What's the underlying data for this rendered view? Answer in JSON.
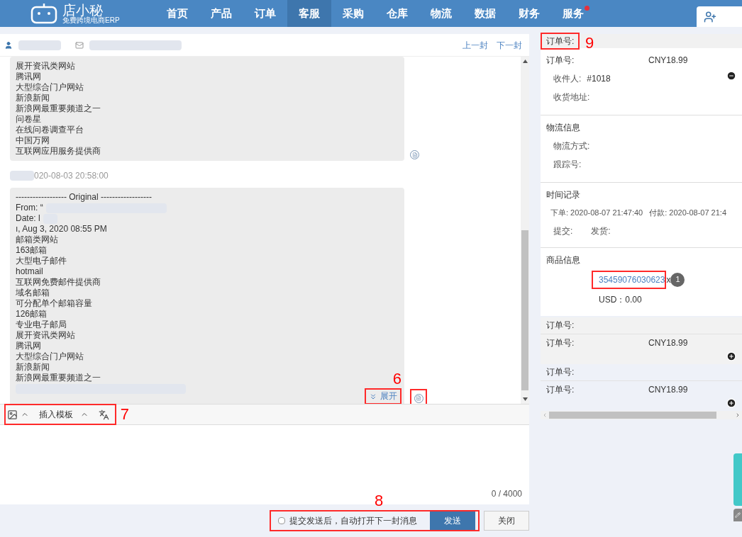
{
  "header": {
    "logo_title": "店小秘",
    "logo_subtitle": "免费跨境电商ERP",
    "nav": [
      {
        "label": "首页",
        "selected": false,
        "dot": false
      },
      {
        "label": "产品",
        "selected": false,
        "dot": false
      },
      {
        "label": "订单",
        "selected": false,
        "dot": false
      },
      {
        "label": "客服",
        "selected": true,
        "dot": false
      },
      {
        "label": "采购",
        "selected": false,
        "dot": false
      },
      {
        "label": "仓库",
        "selected": false,
        "dot": false
      },
      {
        "label": "物流",
        "selected": false,
        "dot": false
      },
      {
        "label": "数据",
        "selected": false,
        "dot": false
      },
      {
        "label": "财务",
        "selected": false,
        "dot": false
      },
      {
        "label": "服务",
        "selected": false,
        "dot": true
      }
    ]
  },
  "conversation": {
    "prev_link": "上一封",
    "next_link": "下一封",
    "messages": [
      {
        "lines": [
          "展开资讯类网站",
          "腾讯网",
          "大型综合门户网站",
          "新浪新闻",
          "新浪网最重要频道之一",
          "问卷星",
          "在线问卷调查平台",
          "中国万网",
          "互联网应用服务提供商"
        ]
      },
      {
        "timestamp": "020-08-03 20:58:00",
        "lines": [
          "------------------ Original ------------------",
          "From: “",
          "Date: l",
          "ı, Aug 3, 2020 08:55 PM",
          "邮箱类网站",
          "163邮箱",
          "大型电子邮件",
          "hotmail",
          "互联网免费邮件提供商",
          "域名邮箱",
          "可分配单个邮箱容量",
          "126邮箱",
          "专业电子邮局",
          "展开资讯类网站",
          "腾讯网",
          "大型综合门户网站",
          "新浪新闻",
          "新浪网最重要频道之一"
        ],
        "expand": "展开"
      }
    ],
    "toolbar": {
      "template_label": "插入模板"
    },
    "reply": {
      "counter": "0 / 4000"
    },
    "auto_next": {
      "label": "提交发送后，自动打开下一封消息",
      "checked": false
    },
    "send_button": "发送",
    "close_button": "关闭"
  },
  "order_panel": {
    "title": "订单号:",
    "order": {
      "number_label": "订单号:",
      "amount": "CNY18.99",
      "recipient_label": "收件人:",
      "recipient": "#1018",
      "address_label": "收货地址:"
    },
    "logistics": {
      "title": "物流信息",
      "method_label": "物流方式:",
      "tracking_label": "跟踪号:"
    },
    "timeline": {
      "title": "时间记录",
      "ordered_label": "下单:",
      "ordered": "2020-08-07 21:47:40",
      "paid_label": "付款:",
      "paid": "2020-08-07 21:4",
      "submitted_label": "提交:",
      "shipped_label": "发货:"
    },
    "products": {
      "title": "商品信息",
      "sku": "35459076030623",
      "times": "x",
      "quantity": "1",
      "price": "USD：0.00"
    },
    "other_orders": [
      {
        "title": "订单号:",
        "number_label": "订单号:",
        "amount": "CNY18.99"
      },
      {
        "title": "订单号:",
        "number_label": "订单号:",
        "amount": "CNY18.99"
      }
    ]
  },
  "annotations": {
    "expand": "6",
    "toolbar": "7",
    "send": "8",
    "order_title": "9"
  }
}
